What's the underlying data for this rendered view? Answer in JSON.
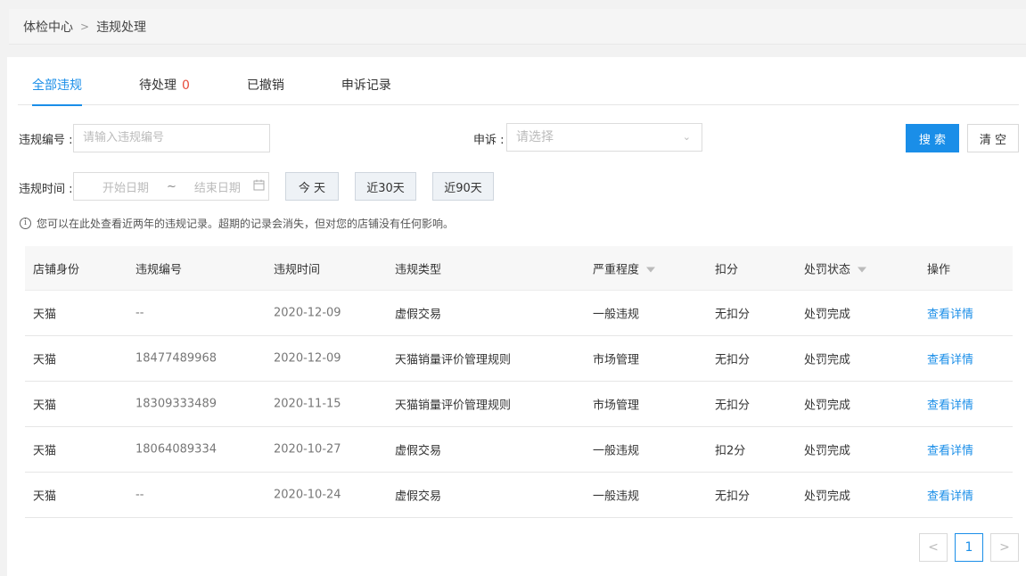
{
  "breadcrumb": {
    "root": "体检中心",
    "separator": ">",
    "current": "违规处理"
  },
  "tabs": [
    {
      "label": "全部违规",
      "count": ""
    },
    {
      "label": "待处理",
      "count": "0"
    },
    {
      "label": "已撤销",
      "count": ""
    },
    {
      "label": "申诉记录",
      "count": ""
    }
  ],
  "filters": {
    "violation_no_label": "违规编号 :",
    "violation_no_placeholder": "请输入违规编号",
    "appeal_label": "申诉 :",
    "appeal_placeholder": "请选择",
    "time_label": "违规时间 :",
    "start_date_placeholder": "开始日期",
    "range_separator": "~",
    "end_date_placeholder": "结束日期",
    "quick_today": "今 天",
    "quick_30": "近30天",
    "quick_90": "近90天",
    "search_button": "搜 索",
    "clear_button": "清 空"
  },
  "notice": "您可以在此处查看近两年的违规记录。超期的记录会消失，但对您的店铺没有任何影响。",
  "table": {
    "headers": [
      "店铺身份",
      "违规编号",
      "违规时间",
      "违规类型",
      "严重程度",
      "扣分",
      "处罚状态",
      "操作"
    ],
    "rows": [
      {
        "shop": "天猫",
        "no": "--",
        "time": "2020-12-09",
        "type": "虚假交易",
        "level": "一般违规",
        "points": "无扣分",
        "status": "处罚完成",
        "action": "查看详情"
      },
      {
        "shop": "天猫",
        "no": "18477489968",
        "time": "2020-12-09",
        "type": "天猫销量评价管理规则",
        "level": "市场管理",
        "points": "无扣分",
        "status": "处罚完成",
        "action": "查看详情"
      },
      {
        "shop": "天猫",
        "no": "18309333489",
        "time": "2020-11-15",
        "type": "天猫销量评价管理规则",
        "level": "市场管理",
        "points": "无扣分",
        "status": "处罚完成",
        "action": "查看详情"
      },
      {
        "shop": "天猫",
        "no": "18064089334",
        "time": "2020-10-27",
        "type": "虚假交易",
        "level": "一般违规",
        "points": "扣2分",
        "status": "处罚完成",
        "action": "查看详情"
      },
      {
        "shop": "天猫",
        "no": "--",
        "time": "2020-10-24",
        "type": "虚假交易",
        "level": "一般违规",
        "points": "无扣分",
        "status": "处罚完成",
        "action": "查看详情"
      }
    ]
  },
  "pagination": {
    "prev": "<",
    "current": "1",
    "next": ">"
  }
}
